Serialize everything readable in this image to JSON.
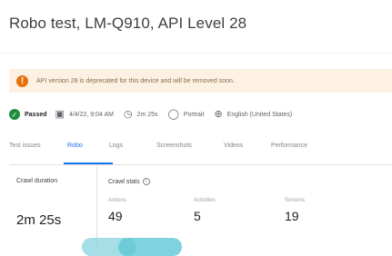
{
  "page": {
    "title": "Robo test, LM-Q910, API Level 28"
  },
  "warning": {
    "text": "API version 28 is deprecated for this device and will be removed soon."
  },
  "meta": {
    "status": "Passed",
    "time": "4/4/22, 9:04 AM",
    "duration": "2m 25s",
    "orientation": "Portrait",
    "locale": "English (United States)"
  },
  "tabs": [
    "Test issues",
    "Robo",
    "Logs",
    "Screenshots",
    "Videos",
    "Performance"
  ],
  "active_tab": "Robo",
  "crawl_duration": {
    "label": "Crawl duration",
    "value": "2m 25s"
  },
  "crawl_stats": {
    "label": "Crawl stats",
    "items": [
      {
        "label": "Actions",
        "value": "49"
      },
      {
        "label": "Activities",
        "value": "5"
      },
      {
        "label": "Screens",
        "value": "19"
      }
    ]
  },
  "colors": {
    "accent": "#1a73e8",
    "passed": "#1e8e3e",
    "warning": "#e8710a",
    "warning_bg": "#fdf1e4"
  },
  "icons": {
    "status": "check-circle-icon",
    "time": "calendar-icon",
    "duration": "timer-icon",
    "orientation": "portrait-icon",
    "locale": "globe-icon"
  }
}
